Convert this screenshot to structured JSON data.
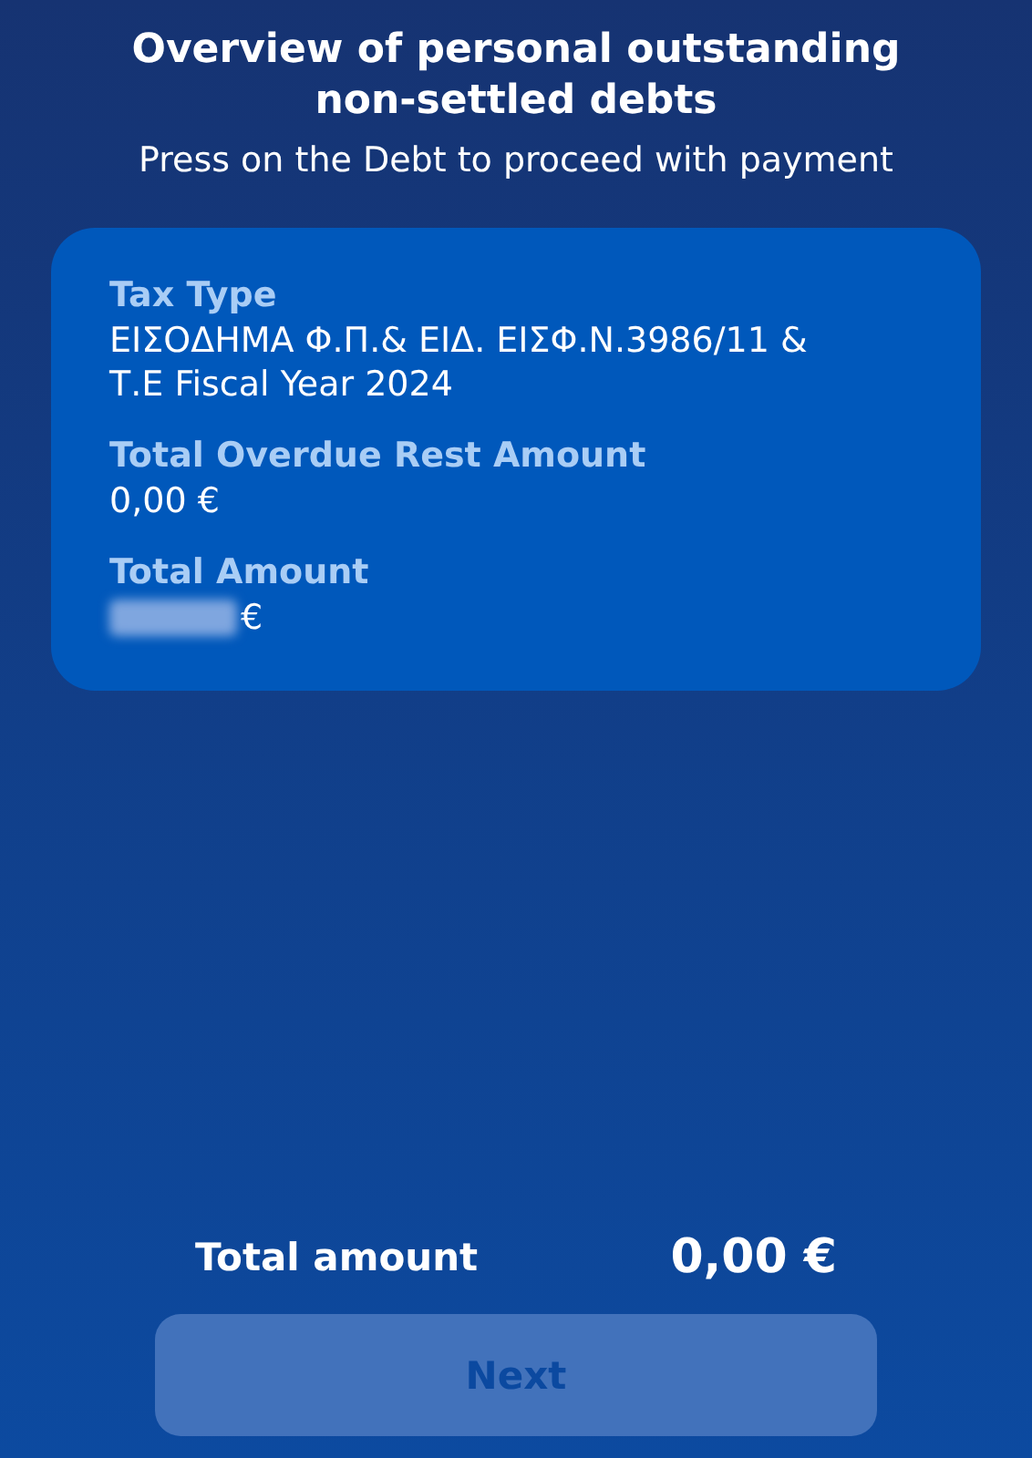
{
  "header": {
    "title": "Overview of personal outstanding non-settled debts",
    "subtitle": "Press on the Debt to proceed with payment"
  },
  "debts": [
    {
      "fields": [
        {
          "label": "Tax Type",
          "value": "ΕΙΣΟΔΗΜΑ Φ.Π.& ΕΙΔ. ΕΙΣΦ.Ν.3986/11 & Τ.Ε Fiscal Year 2024",
          "redacted": false
        },
        {
          "label": "Total Overdue Rest Amount",
          "value": "0,00 €",
          "redacted": false
        },
        {
          "label": "Total Amount",
          "value": "€",
          "redacted": true
        }
      ]
    }
  ],
  "footer": {
    "total_label": "Total amount",
    "total_value": "0,00 €",
    "button": {
      "label": "Next",
      "disabled": true
    }
  }
}
